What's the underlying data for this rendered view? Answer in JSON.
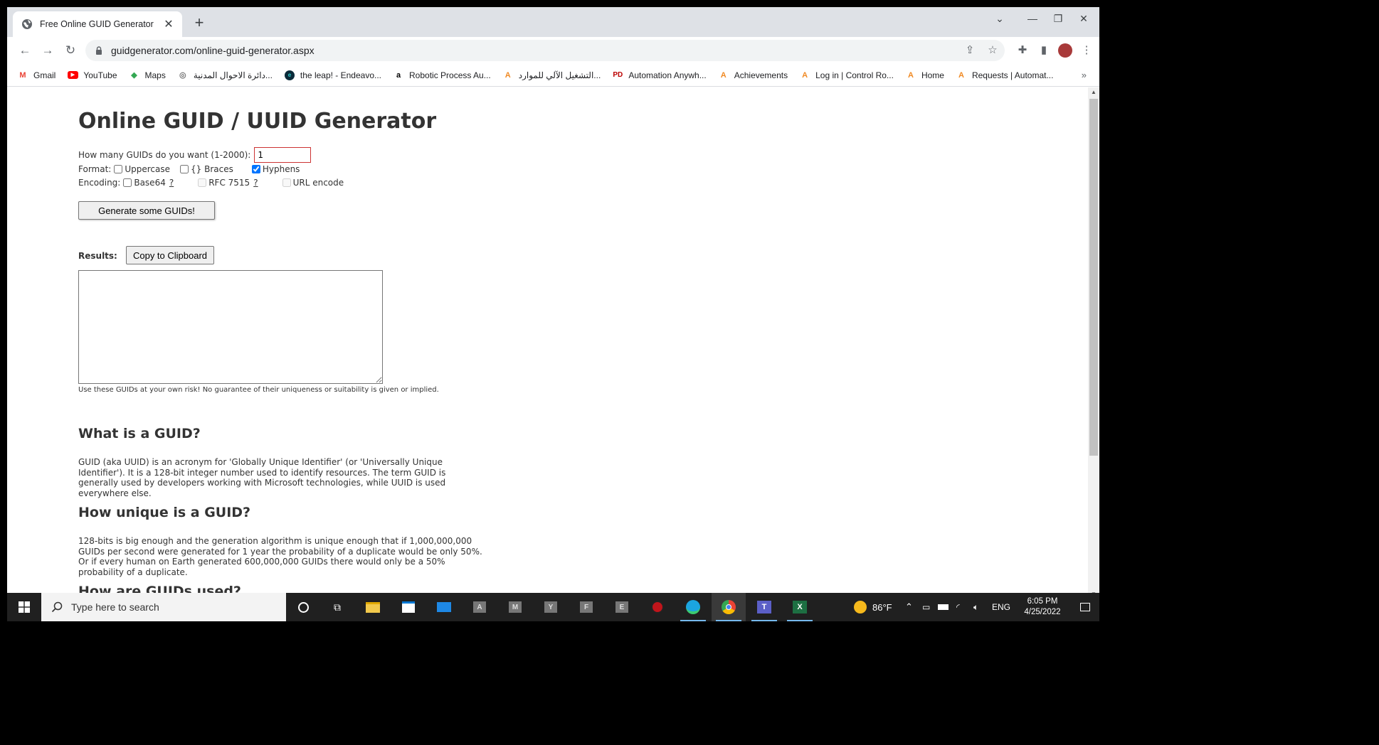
{
  "browser": {
    "tab_title": "Free Online GUID Generator",
    "url": "guidgenerator.com/online-guid-generator.aspx",
    "bookmarks": [
      {
        "label": "Gmail",
        "icon": "gmail-icon"
      },
      {
        "label": "YouTube",
        "icon": "youtube-icon"
      },
      {
        "label": "Maps",
        "icon": "maps-icon"
      },
      {
        "label": "دائرة الاحوال المدنية...",
        "icon": "gov-icon"
      },
      {
        "label": "the leap! - Endeavo...",
        "icon": "leap-icon"
      },
      {
        "label": "Robotic Process Au...",
        "icon": "amazon-icon"
      },
      {
        "label": "التشغيل الآلي للموارد...",
        "icon": "automation-anywhere-icon"
      },
      {
        "label": "Automation Anywh...",
        "icon": "pd-icon"
      },
      {
        "label": "Achievements",
        "icon": "automation-anywhere-icon"
      },
      {
        "label": "Log in | Control Ro...",
        "icon": "automation-anywhere-icon"
      },
      {
        "label": "Home",
        "icon": "automation-anywhere-icon"
      },
      {
        "label": "Requests | Automat...",
        "icon": "automation-anywhere-icon"
      }
    ],
    "bookmarks_more": "»"
  },
  "page": {
    "title": "Online GUID / UUID Generator",
    "count_label": "How many GUIDs do you want (1-2000):",
    "count_value": "1",
    "format_label": "Format:",
    "format_options": {
      "uppercase": {
        "label": "Uppercase",
        "checked": false
      },
      "braces": {
        "label": "{} Braces",
        "checked": false
      },
      "hyphens": {
        "label": "Hyphens",
        "checked": true
      }
    },
    "encoding_label": "Encoding:",
    "encoding_options": {
      "base64": {
        "label": "Base64",
        "help": "?",
        "checked": false
      },
      "rfc7515": {
        "label": "RFC 7515",
        "help": "?",
        "checked": false,
        "disabled": true
      },
      "urlencode": {
        "label": "URL encode",
        "checked": false,
        "disabled": true
      }
    },
    "generate_button": "Generate some GUIDs!",
    "results_label": "Results:",
    "copy_button": "Copy to Clipboard",
    "results_value": "",
    "disclaimer": "Use these GUIDs at your own risk! No guarantee of their uniqueness or suitability is given or implied.",
    "sections": [
      {
        "heading": "What is a GUID?",
        "text": "GUID (aka UUID) is an acronym for 'Globally Unique Identifier' (or 'Universally Unique Identifier'). It is a 128-bit integer number used to identify resources. The term GUID is generally used by developers working with Microsoft technologies, while UUID is used everywhere else."
      },
      {
        "heading": "How unique is a GUID?",
        "text": "128-bits is big enough and the generation algorithm is unique enough that if 1,000,000,000 GUIDs per second were generated for 1 year the probability of a duplicate would be only 50%. Or if every human on Earth generated 600,000,000 GUIDs there would only be a 50% probability of a duplicate."
      },
      {
        "heading": "How are GUIDs used?",
        "text": ""
      }
    ]
  },
  "taskbar": {
    "search_placeholder": "Type here to search",
    "apps": [
      {
        "name": "cortana-icon"
      },
      {
        "name": "task-view-icon"
      },
      {
        "name": "file-explorer-icon"
      },
      {
        "name": "store-icon"
      },
      {
        "name": "mail-icon"
      },
      {
        "name": "app-a-icon",
        "letter": "A"
      },
      {
        "name": "app-m-icon",
        "letter": "M"
      },
      {
        "name": "app-y-icon",
        "letter": "Y"
      },
      {
        "name": "app-f-icon",
        "letter": "F"
      },
      {
        "name": "app-e-icon",
        "letter": "E"
      },
      {
        "name": "automation-icon"
      },
      {
        "name": "edge-icon"
      },
      {
        "name": "chrome-icon"
      },
      {
        "name": "teams-icon"
      },
      {
        "name": "excel-icon"
      }
    ],
    "weather": "86°F",
    "language": "ENG",
    "time": "6:05 PM",
    "date": "4/25/2022"
  }
}
